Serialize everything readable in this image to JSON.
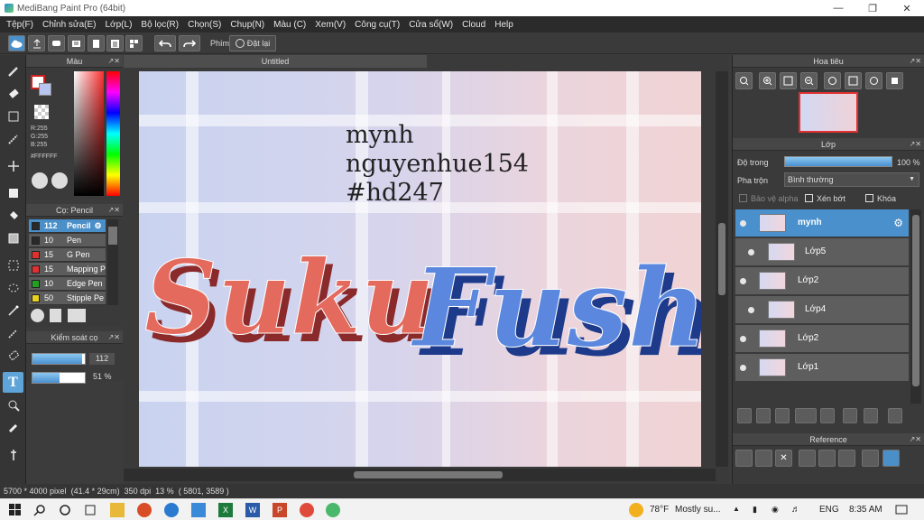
{
  "window": {
    "title": "MediBang Paint Pro (64bit)"
  },
  "menu": [
    "Tệp(F)",
    "Chỉnh sửa(E)",
    "Lớp(L)",
    "Bộ lọc(R)",
    "Chọn(S)",
    "Chụp(N)",
    "Màu (C)",
    "Xem(V)",
    "Công cụ(T)",
    "Cửa sổ(W)",
    "Cloud",
    "Help"
  ],
  "toolbar": {
    "phim_label": "Phím",
    "reset_label": "Đặt lại"
  },
  "document": {
    "tab_title": "Untitled"
  },
  "color_panel": {
    "title": "Màu",
    "r": "R:255",
    "g": "G:255",
    "b": "B:255",
    "hex": "#FFFFFF"
  },
  "brush_panel": {
    "title": "Cọ: Pencil",
    "items": [
      {
        "size": "112",
        "name": "Pencil",
        "color": "#2a2a2a",
        "selected": true
      },
      {
        "size": "10",
        "name": "Pen",
        "color": "#2a2a2a"
      },
      {
        "size": "15",
        "name": "G Pen",
        "color": "#e23030"
      },
      {
        "size": "15",
        "name": "Mapping P",
        "color": "#e23030"
      },
      {
        "size": "10",
        "name": "Edge Pen",
        "color": "#22a022"
      },
      {
        "size": "50",
        "name": "Stipple Pe",
        "color": "#e8d020"
      }
    ]
  },
  "control_panel": {
    "title": "Kiểm soát cọ",
    "size_value": "112",
    "opacity_value": "51 %",
    "size_fraction": 0.95,
    "opacity_fraction": 0.51
  },
  "canvas": {
    "text_lines": [
      "mynh",
      "nguyenhue154",
      "#hd247"
    ],
    "lettering_left": "Suku",
    "lettering_right": "Fushi"
  },
  "navigator": {
    "title": "Hoa tiêu"
  },
  "layer_panel": {
    "title": "Lớp",
    "opacity_label": "Độ trong",
    "opacity_value": "100 %",
    "blend_label": "Pha trộn",
    "blend_value": "Bình thường",
    "protect_alpha": "Bảo vệ alpha",
    "clip": "Xén bớt",
    "lock": "Khóa",
    "layers": [
      {
        "name": "mynh",
        "selected": true
      },
      {
        "name": "Lớp5"
      },
      {
        "name": "Lớp2"
      },
      {
        "name": "Lớp4"
      },
      {
        "name": "Lớp2"
      },
      {
        "name": "Lớp1"
      }
    ]
  },
  "reference_panel": {
    "title": "Reference"
  },
  "status_bar": {
    "size_info": "5700 * 4000 pixel",
    "physical": "(41.4 * 29cm)",
    "dpi": "350 dpi",
    "zoom": "13 %",
    "coords": "( 5801, 3589 )"
  },
  "taskbar": {
    "weather": "78°F",
    "weather_text": "Mostly su...",
    "lang": "ENG",
    "time": "8:35 AM"
  }
}
